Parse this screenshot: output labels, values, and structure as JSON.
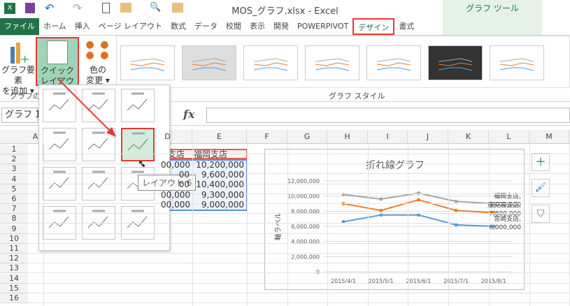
{
  "app": {
    "title": "MOS_グラフ.xlsx - Excel",
    "context_tab": "グラフ ツール"
  },
  "tabs": [
    "ファイル",
    "ホーム",
    "挿入",
    "ページ レイアウト",
    "数式",
    "データ",
    "校閲",
    "表示",
    "開発",
    "POWERPIVOT",
    "デザイン",
    "書式"
  ],
  "active_tab": "デザイン",
  "ribbon": {
    "add_element": [
      "グラフ要素",
      "を追加 ▾"
    ],
    "quick_layout": [
      "クイック",
      "レイアウト ▾"
    ],
    "change_color": [
      "色の",
      "変更 ▾"
    ],
    "group_layout": "グラフのレ",
    "group_styles": "グラフ スタイル"
  },
  "formula": {
    "name_box": "グラフ 1",
    "fx": "fx"
  },
  "columns": [
    "A",
    "D",
    "E",
    "F",
    "G",
    "H",
    "I",
    "J",
    "K",
    "L",
    "M"
  ],
  "rows": [
    "1",
    "2",
    "3",
    "4",
    "5",
    "6",
    "7",
    "8",
    "9",
    "10",
    "11",
    "12",
    "13",
    "14",
    "15",
    "16"
  ],
  "cells": {
    "d2": "支店",
    "e2": "福岡支店",
    "d": [
      "00,000",
      "00",
      "00",
      "00,000",
      "00,000"
    ],
    "e": [
      "10,200,000",
      "9,600,000",
      "10,400,000",
      "9,300,000",
      "9,000,000"
    ]
  },
  "tooltip": "レイアウト 6",
  "chart_data": {
    "type": "line",
    "title": "折れ線グラフ",
    "ylabel": "軸ラベル",
    "categories": [
      "2015/4/1",
      "2015/5/1",
      "2015/6/1",
      "2015/7/1",
      "2015/8/1"
    ],
    "ylim": [
      0,
      12000000
    ],
    "yticks": [
      "0",
      "2,000,000",
      "4,000,000",
      "6,000,000",
      "8,000,000",
      "10,000,000",
      "12,000,000"
    ],
    "grid": true,
    "series": [
      {
        "name": "福岡支店",
        "color": "#a5a5a5",
        "values": [
          10200000,
          9600000,
          10400000,
          9300000,
          9000000
        ],
        "label": [
          "福岡支店,",
          "9,000,000"
        ]
      },
      {
        "name": "鹿児島支店",
        "color": "#ed7d31",
        "values": [
          9000000,
          8100000,
          9500000,
          8100000,
          7800000
        ],
        "label": [
          "鹿児島支店,",
          "7,800,000"
        ]
      },
      {
        "name": "宮崎支店",
        "color": "#5b9bd5",
        "values": [
          6600000,
          7500000,
          7500000,
          6200000,
          6000000
        ],
        "label": [
          "宮崎支店,",
          "6,000,000"
        ]
      }
    ]
  },
  "side_buttons": [
    "+",
    "🖌",
    "⛉"
  ]
}
